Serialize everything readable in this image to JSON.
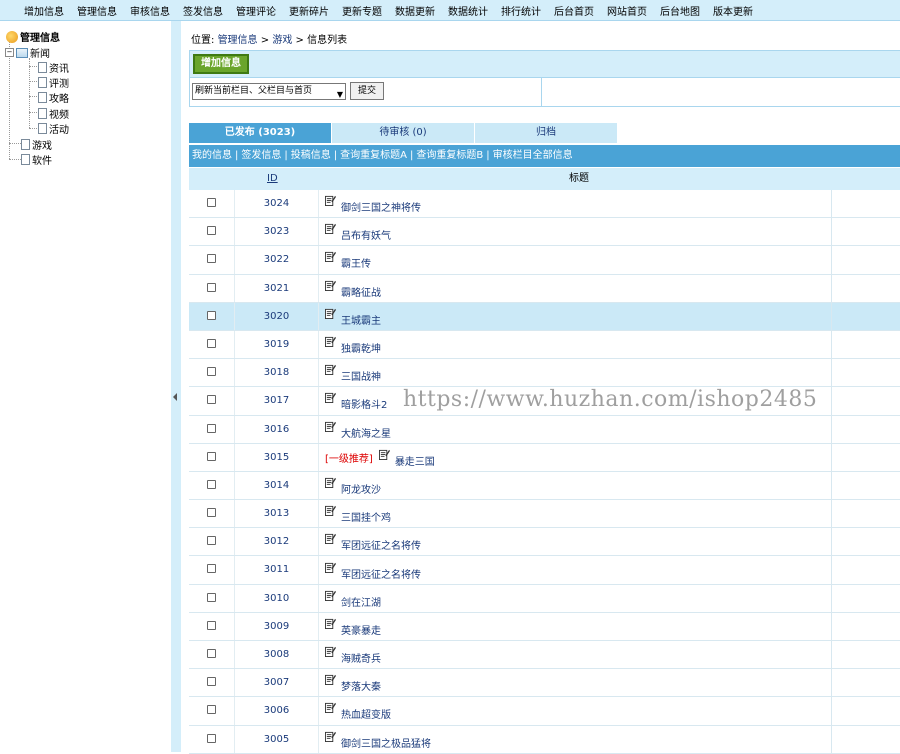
{
  "top_menu": [
    "增加信息",
    "管理信息",
    "审核信息",
    "签发信息",
    "管理评论",
    "更新碎片",
    "更新专题",
    "数据更新",
    "数据统计",
    "排行统计",
    "后台首页",
    "网站首页",
    "后台地图",
    "版本更新"
  ],
  "tree": {
    "root": "管理信息",
    "news": "新闻",
    "news_children": [
      "资讯",
      "评测",
      "攻略",
      "视频",
      "活动"
    ],
    "game": "游戏",
    "software": "软件"
  },
  "breadcrumb": {
    "prefix": "位置:",
    "link1": "管理信息",
    "sep1": ">",
    "link2": "游戏",
    "sep2": ">",
    "current": "信息列表"
  },
  "actions": {
    "add_label": "增加信息",
    "refresh_select": "刷新当前栏目、父栏目与首页",
    "submit_label": "提交"
  },
  "tabs": [
    "已发布 (3023)",
    "待审核 (0)",
    "归档"
  ],
  "sublinks": [
    "我的信息",
    "签发信息",
    "投稿信息",
    "查询重复标题A",
    "查询重复标题B",
    "审核栏目全部信息"
  ],
  "sublink_sep": "|",
  "table": {
    "col_id": "ID",
    "col_title": "标题",
    "rows": [
      {
        "id": "3024",
        "title": "御剑三国之神将传",
        "rec": ""
      },
      {
        "id": "3023",
        "title": "吕布有妖气",
        "rec": ""
      },
      {
        "id": "3022",
        "title": "霸王传",
        "rec": ""
      },
      {
        "id": "3021",
        "title": "霸略征战",
        "rec": ""
      },
      {
        "id": "3020",
        "title": "王城霸主",
        "rec": ""
      },
      {
        "id": "3019",
        "title": "独霸乾坤",
        "rec": ""
      },
      {
        "id": "3018",
        "title": "三国战神",
        "rec": ""
      },
      {
        "id": "3017",
        "title": "暗影格斗2",
        "rec": ""
      },
      {
        "id": "3016",
        "title": "大航海之星",
        "rec": ""
      },
      {
        "id": "3015",
        "title": "暴走三国",
        "rec": "[一级推荐]"
      },
      {
        "id": "3014",
        "title": "阿龙攻沙",
        "rec": ""
      },
      {
        "id": "3013",
        "title": "三国挂个鸡",
        "rec": ""
      },
      {
        "id": "3012",
        "title": "军团远征之名将传",
        "rec": ""
      },
      {
        "id": "3011",
        "title": "军团远征之名将传",
        "rec": ""
      },
      {
        "id": "3010",
        "title": "剑在江湖",
        "rec": ""
      },
      {
        "id": "3009",
        "title": "英豪暴走",
        "rec": ""
      },
      {
        "id": "3008",
        "title": "海贼奇兵",
        "rec": ""
      },
      {
        "id": "3007",
        "title": "梦落大秦",
        "rec": ""
      },
      {
        "id": "3006",
        "title": "热血超变版",
        "rec": ""
      },
      {
        "id": "3005",
        "title": "御剑三国之极品猛将",
        "rec": ""
      }
    ],
    "highlighted_row": 4
  },
  "watermark": "https://www.huzhan.com/ishop2485",
  "colors": {
    "menu_bg": "#d4eefa",
    "tab_active": "#4aa3d6",
    "add_button": "#6aa52b",
    "recommend": "#dd0000"
  }
}
